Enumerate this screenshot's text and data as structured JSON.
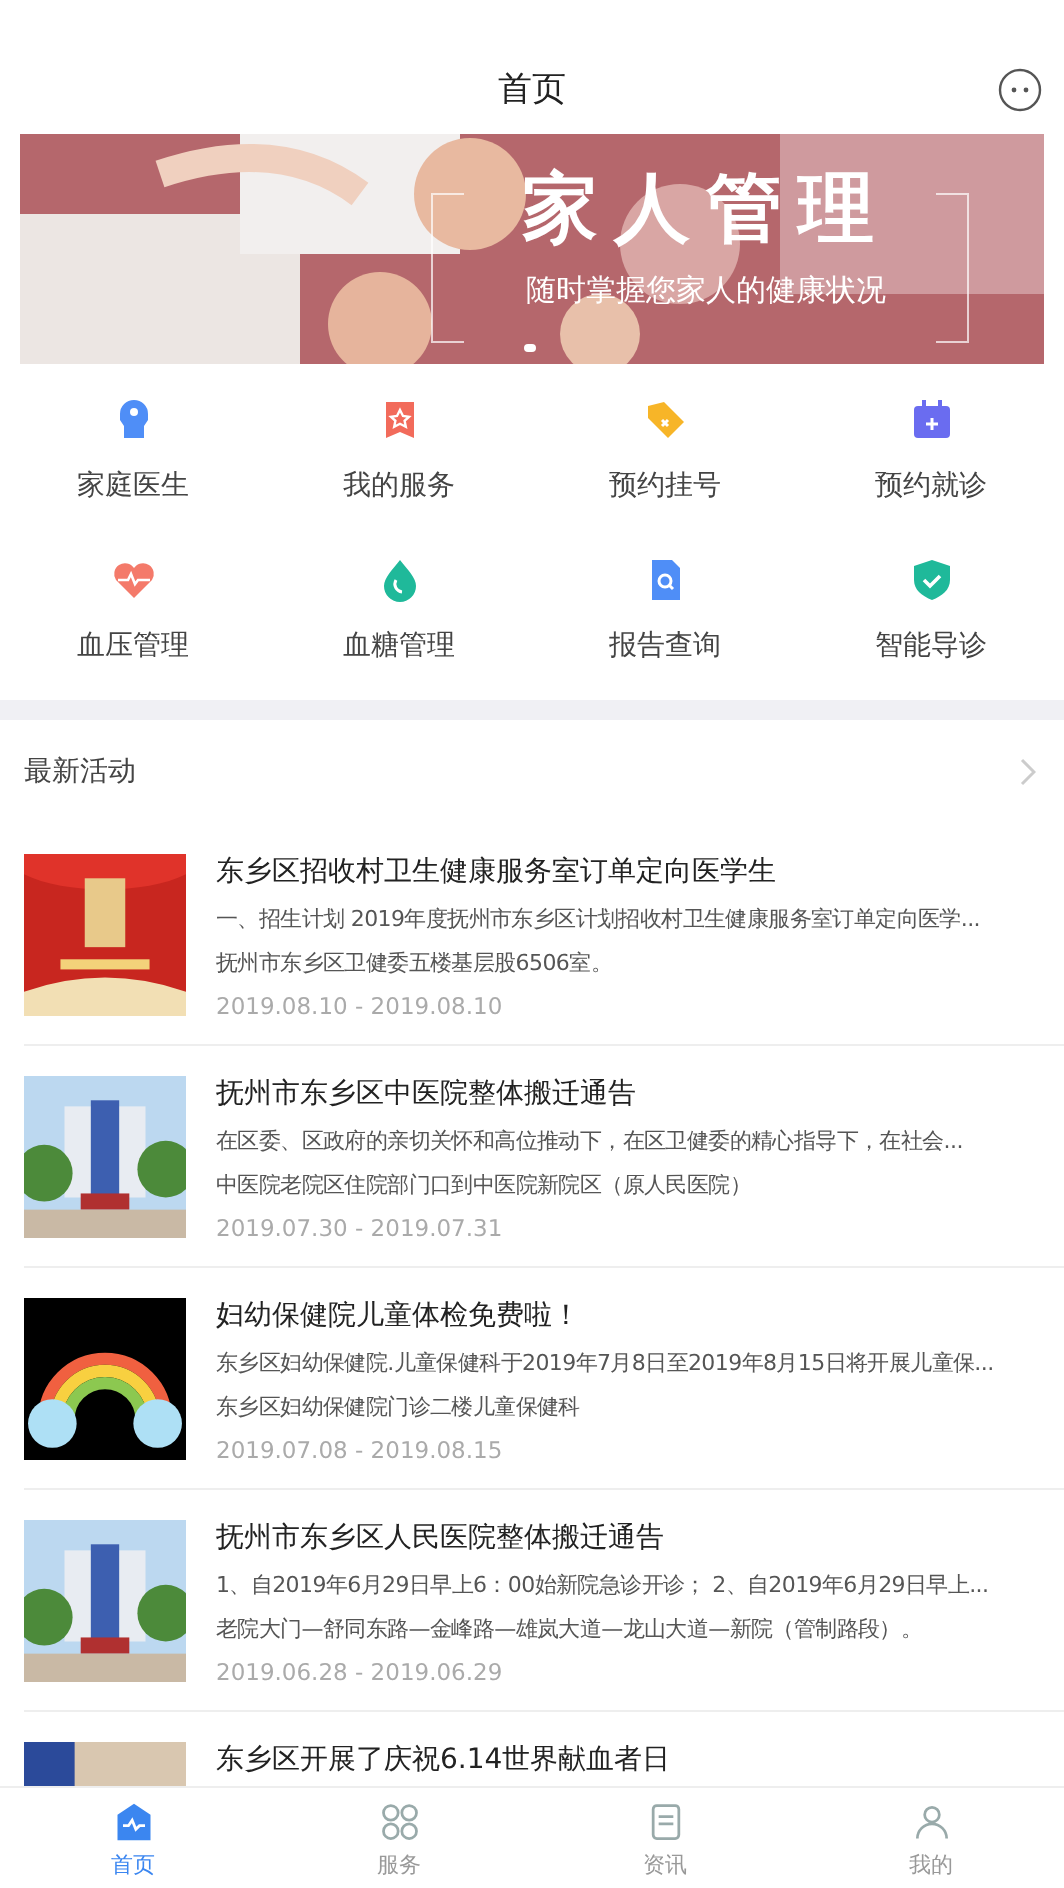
{
  "header": {
    "title": "首页"
  },
  "banner": {
    "headline": "家人管理",
    "subtitle": "随时掌握您家人的健康状况",
    "dots": [
      {
        "selected": true
      }
    ]
  },
  "services": [
    {
      "label": "家庭医生",
      "color": "#4f8ef7"
    },
    {
      "label": "我的服务",
      "color": "#f26b5b"
    },
    {
      "label": "预约挂号",
      "color": "#f7b528"
    },
    {
      "label": "预约就诊",
      "color": "#6a6cf0"
    },
    {
      "label": "血压管理",
      "color": "#f47a6a"
    },
    {
      "label": "血糖管理",
      "color": "#1fb99a"
    },
    {
      "label": "报告查询",
      "color": "#4f8ef7"
    },
    {
      "label": "智能导诊",
      "color": "#1fb99a"
    }
  ],
  "section": {
    "title": "最新活动"
  },
  "activities": [
    {
      "title": "东乡区招收村卫生健康服务室订单定向医学生",
      "summary": "一、招生计划 2019年度抚州市东乡区计划招收村卫生健康服务室订单定向医学...",
      "place": "抚州市东乡区卫健委五楼基层股6506室。",
      "dates": "2019.08.10 - 2019.08.10"
    },
    {
      "title": "抚州市东乡区中医院整体搬迁通告",
      "summary": "在区委、区政府的亲切关怀和高位推动下，在区卫健委的精心指导下，在社会...",
      "place": "中医院老院区住院部门口到中医院新院区（原人民医院）",
      "dates": "2019.07.30 - 2019.07.31"
    },
    {
      "title": "妇幼保健院儿童体检免费啦！",
      "summary": "东乡区妇幼保健院.儿童保健科于2019年7月8日至2019年8月15日将开展儿童保...",
      "place": "东乡区妇幼保健院门诊二楼儿童保健科",
      "dates": "2019.07.08 - 2019.08.15"
    },
    {
      "title": "抚州市东乡区人民医院整体搬迁通告",
      "summary": "1、自2019年6月29日早上6：00始新院急诊开诊； 2、自2019年6月29日早上...",
      "place": "老院大门—舒同东路—金峰路—雄岚大道—龙山大道—新院（管制路段）。",
      "dates": "2019.06.28 - 2019.06.29"
    },
    {
      "title": "东乡区开展了庆祝6.14世界献血者日"
    }
  ],
  "tabbar": [
    {
      "label": "首页",
      "selected": true
    },
    {
      "label": "服务",
      "selected": false
    },
    {
      "label": "资讯",
      "selected": false
    },
    {
      "label": "我的",
      "selected": false
    }
  ]
}
